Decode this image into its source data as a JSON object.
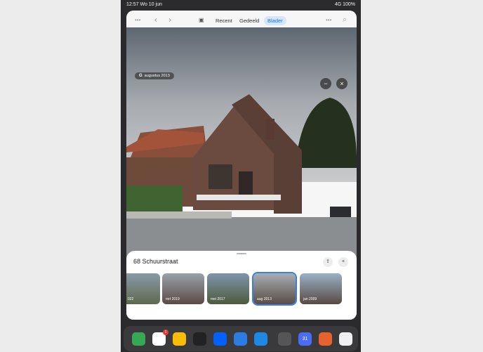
{
  "status": {
    "time": "12:57",
    "date": "Wo 10 jun",
    "signal": "4G 100%"
  },
  "toolbar": {
    "more": "•••",
    "back": "‹",
    "forward": "›",
    "sidebar_icon": "▣",
    "tabs": [
      "Recent",
      "Gedeeld",
      "Blader"
    ],
    "active_tab": "Blader",
    "more_right": "•••",
    "search": "⌕"
  },
  "photo": {
    "date_pill": "augustus 2013",
    "minus": "−",
    "close": "×"
  },
  "panel": {
    "address": "68 Schuurstraat",
    "share": "⇪",
    "close": "×",
    "thumbs": [
      {
        "label": "022",
        "selected": false
      },
      {
        "label": "mrt 2019",
        "selected": false
      },
      {
        "label": "mei 2017",
        "selected": false
      },
      {
        "label": "aug 2013",
        "selected": true
      },
      {
        "label": "jan 2009",
        "selected": false
      }
    ]
  },
  "dock": {
    "apps": [
      "maps",
      "gmail",
      "misc",
      "camera",
      "dropbox",
      "safari",
      "files",
      "speaker",
      "calendar",
      "office",
      "games"
    ],
    "calendar_day": "31",
    "gmail_badge": "1"
  }
}
